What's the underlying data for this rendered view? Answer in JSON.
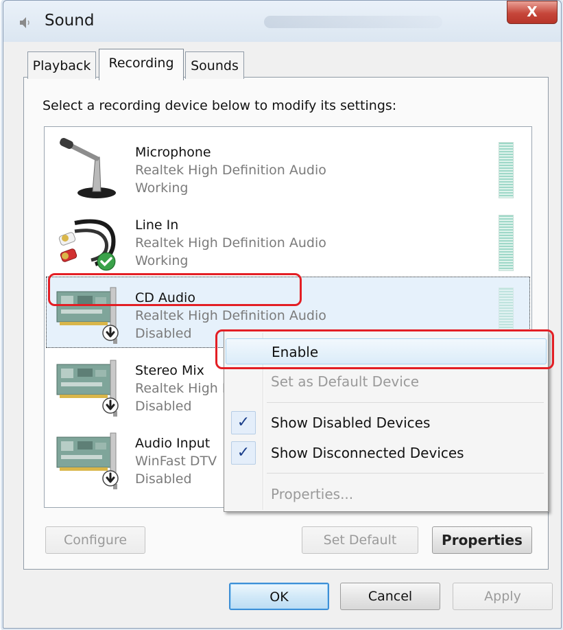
{
  "window": {
    "title": "Sound",
    "close_glyph": "X"
  },
  "tabs": [
    {
      "label": "Playback",
      "active": false
    },
    {
      "label": "Recording",
      "active": true
    },
    {
      "label": "Sounds",
      "active": false
    }
  ],
  "instruction": "Select a recording device below to modify its settings:",
  "devices": [
    {
      "name": "Microphone",
      "driver": "Realtek High Definition Audio",
      "status": "Working",
      "icon": "microphone-icon"
    },
    {
      "name": "Line In",
      "driver": "Realtek High Definition Audio",
      "status": "Working",
      "icon": "line-in-cable-icon",
      "badge": "default-check-badge"
    },
    {
      "name": "CD Audio",
      "driver": "Realtek High Definition Audio",
      "status": "Disabled",
      "icon": "sound-card-icon",
      "badge": "disabled-arrow-badge",
      "selected": true
    },
    {
      "name": "Stereo Mix",
      "driver": "Realtek High Definition Audio",
      "status": "Disabled",
      "icon": "sound-card-icon",
      "badge": "disabled-arrow-badge"
    },
    {
      "name": "Audio Input",
      "driver": "WinFast DTV",
      "status": "Disabled",
      "icon": "sound-card-icon",
      "badge": "disabled-arrow-badge"
    }
  ],
  "context_menu": {
    "items": [
      {
        "label": "Enable",
        "state": "highlighted"
      },
      {
        "label": "Set as Default Device",
        "state": "disabled"
      },
      {
        "label": "Show Disabled Devices",
        "checked": true
      },
      {
        "label": "Show Disconnected Devices",
        "checked": true
      },
      {
        "label": "Properties...",
        "state": "disabled"
      }
    ],
    "check_glyph": "✓"
  },
  "buttons": {
    "configure": "Configure",
    "set_default": "Set Default",
    "properties": "Properties",
    "ok": "OK",
    "cancel": "Cancel",
    "apply": "Apply"
  },
  "annotation_color": "#e31e24",
  "accent_color": "#3d8fd6"
}
